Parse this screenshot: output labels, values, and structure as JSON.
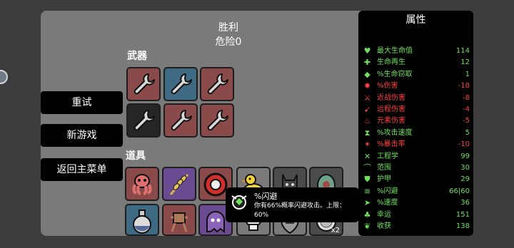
{
  "header": {
    "title": "胜利",
    "danger": "危险0"
  },
  "menu": {
    "retry": "重试",
    "new_game": "新游戏",
    "main_menu": "返回主菜单"
  },
  "sections": {
    "weapons": "武器",
    "items": "道具"
  },
  "weapons": [
    {
      "name": "wrench",
      "tier_color": "#8b4a4a"
    },
    {
      "name": "wrench",
      "tier_color": "#3f6a84"
    },
    {
      "name": "wrench",
      "tier_color": "#8b4a4a"
    },
    {
      "name": "wrench",
      "tier_color": "#262626"
    },
    {
      "name": "wrench",
      "tier_color": "#8b4a4a"
    },
    {
      "name": "wrench",
      "tier_color": "#8b4a4a"
    }
  ],
  "items": [
    {
      "name": "octopus-icon"
    },
    {
      "name": "wheat-icon"
    },
    {
      "name": "tire-icon"
    },
    {
      "name": "duck-icon"
    },
    {
      "name": "demon-icon"
    },
    {
      "name": "egg-icon"
    },
    {
      "name": "potion-icon"
    },
    {
      "name": "robot-icon"
    },
    {
      "name": "ghost-icon"
    },
    {
      "name": "skull-icon"
    },
    {
      "name": "shield-icon"
    },
    {
      "name": "coin-icon",
      "count": "x2"
    }
  ],
  "stats": {
    "title": "属性",
    "rows": [
      {
        "icon": "heart-icon",
        "label": "最大生命值",
        "value": "114",
        "label_color": "#6ee05a",
        "value_color": "#6ee05a"
      },
      {
        "icon": "regen-icon",
        "label": "生命再生",
        "value": "12",
        "label_color": "#6ee05a",
        "value_color": "#6ee05a"
      },
      {
        "icon": "lifesteal-icon",
        "label": "%生命窃取",
        "value": "1",
        "label_color": "#6ee05a",
        "value_color": "#6ee05a"
      },
      {
        "icon": "damage-icon",
        "label": "%伤害",
        "value": "-18",
        "label_color": "#ff4040",
        "value_color": "#ff4040"
      },
      {
        "icon": "melee-icon",
        "label": "近战伤害",
        "value": "-8",
        "label_color": "#ff4040",
        "value_color": "#ff4040"
      },
      {
        "icon": "ranged-icon",
        "label": "远程伤害",
        "value": "-4",
        "label_color": "#ff4040",
        "value_color": "#ff4040"
      },
      {
        "icon": "elemental-icon",
        "label": "元素伤害",
        "value": "-5",
        "label_color": "#ff4040",
        "value_color": "#ff4040"
      },
      {
        "icon": "attack-speed-icon",
        "label": "%攻击速度",
        "value": "5",
        "label_color": "#6ee05a",
        "value_color": "#6ee05a"
      },
      {
        "icon": "crit-icon",
        "label": "%暴击率",
        "value": "-10",
        "label_color": "#ff4040",
        "value_color": "#ff4040"
      },
      {
        "icon": "engineering-icon",
        "label": "工程学",
        "value": "99",
        "label_color": "#6ee05a",
        "value_color": "#6ee05a"
      },
      {
        "icon": "range-icon",
        "label": "范围",
        "value": "30",
        "label_color": "#6ee05a",
        "value_color": "#6ee05a"
      },
      {
        "icon": "armor-icon",
        "label": "护甲",
        "value": "29",
        "label_color": "#6ee05a",
        "value_color": "#6ee05a"
      },
      {
        "icon": "dodge-icon",
        "label": "%闪避",
        "value": "66|60",
        "label_color": "#6ee05a",
        "value_color": "#6ee05a"
      },
      {
        "icon": "speed-icon",
        "label": "%速度",
        "value": "36",
        "label_color": "#6ee05a",
        "value_color": "#6ee05a"
      },
      {
        "icon": "luck-icon",
        "label": "幸运",
        "value": "151",
        "label_color": "#6ee05a",
        "value_color": "#6ee05a"
      },
      {
        "icon": "harvest-icon",
        "label": "收获",
        "value": "138",
        "label_color": "#6ee05a",
        "value_color": "#6ee05a"
      }
    ]
  },
  "tooltip": {
    "title": "%闪避",
    "desc": "你有66%概率闪避攻击。上限：60%"
  },
  "colors": {
    "positive": "#6ee05a",
    "negative": "#ff4040"
  }
}
